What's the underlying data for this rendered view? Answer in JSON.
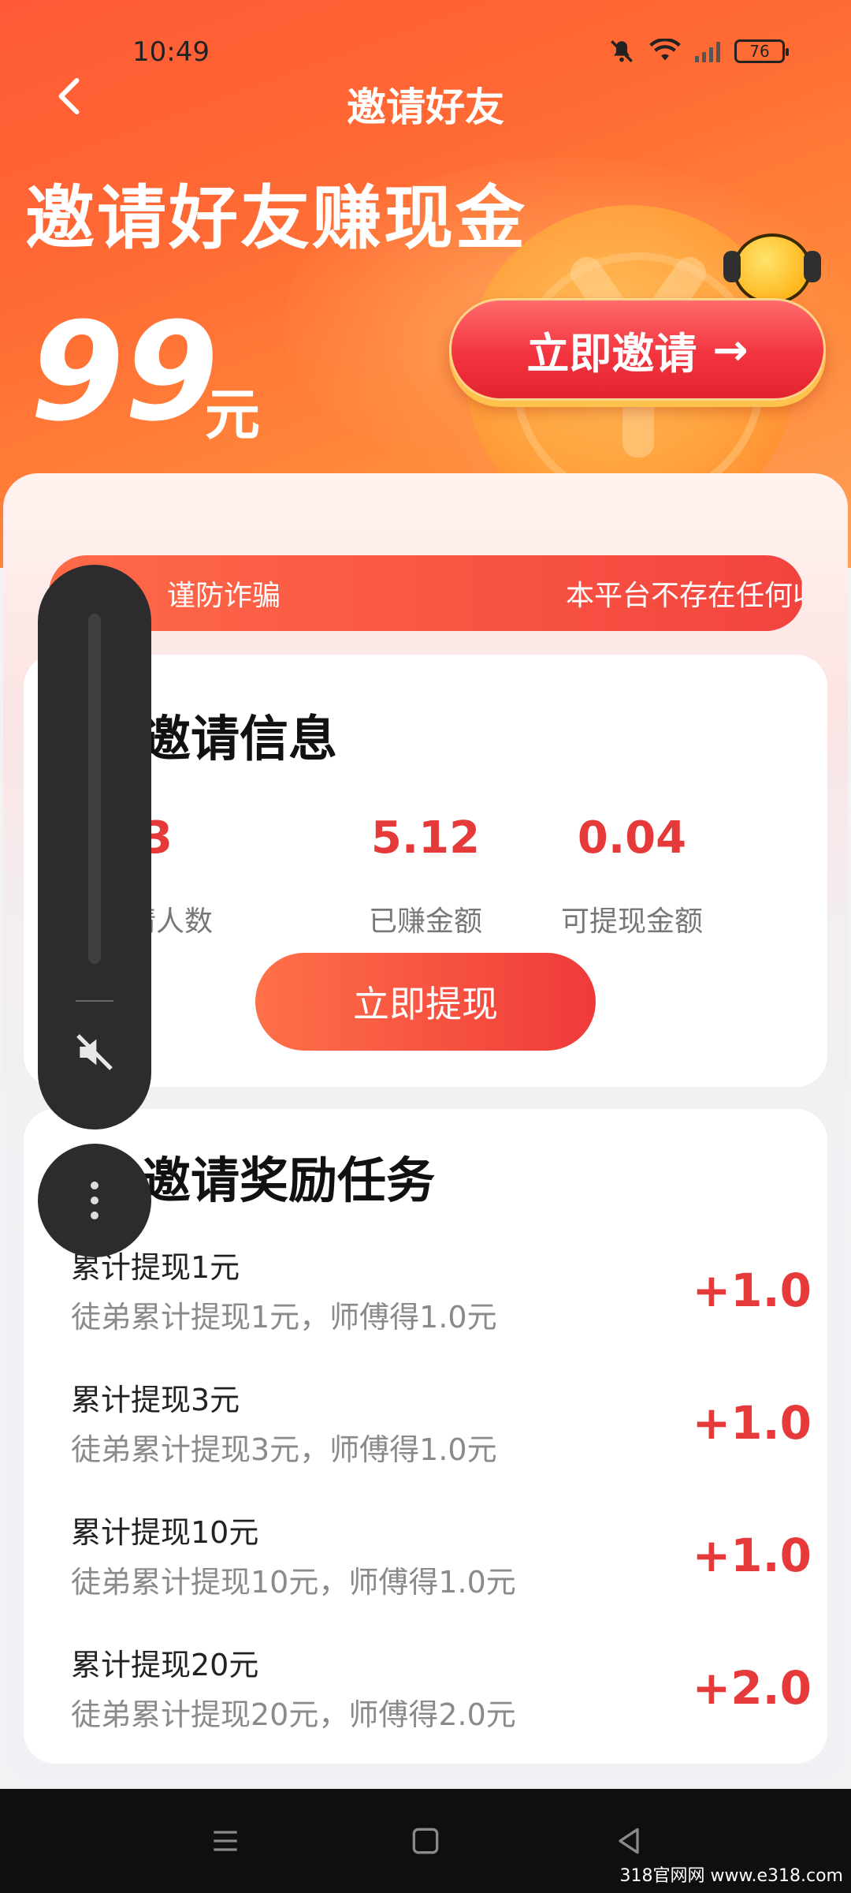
{
  "status_bar": {
    "time": "10:49",
    "battery": "76"
  },
  "header": {
    "title": "邀请好友"
  },
  "hero": {
    "title": "邀请好友赚现金",
    "amount": "99",
    "unit": "元",
    "invite_button": "立即邀请"
  },
  "notice": {
    "label": "谨防诈骗",
    "message": "本平台不存在任何收费"
  },
  "invite_info": {
    "title": "邀请信息",
    "stats": [
      {
        "value": "13",
        "label": "已邀请人数"
      },
      {
        "value": "5.12",
        "label": "已赚金额"
      },
      {
        "value": "0.04",
        "label": "可提现金额"
      }
    ],
    "withdraw_button": "立即提现"
  },
  "tasks": {
    "title": "邀请奖励任务",
    "items": [
      {
        "title": "累计提现1元",
        "desc": "徒弟累计提现1元，师傅得1.0元",
        "reward": "+1.0"
      },
      {
        "title": "累计提现3元",
        "desc": "徒弟累计提现3元，师傅得1.0元",
        "reward": "+1.0"
      },
      {
        "title": "累计提现10元",
        "desc": "徒弟累计提现10元，师傅得1.0元",
        "reward": "+1.0"
      },
      {
        "title": "累计提现20元",
        "desc": "徒弟累计提现20元，师傅得2.0元",
        "reward": "+2.0"
      }
    ]
  },
  "watermark": "318官网网 www.e318.com",
  "colors": {
    "accent": "#e63a3a",
    "hero_start": "#ff5a36",
    "hero_end": "#ffa15a"
  },
  "icons": [
    "back-arrow-icon",
    "mute-bell-icon",
    "wifi-icon",
    "signal-icon",
    "battery-icon",
    "volume-mute-icon",
    "more-dots-icon",
    "menu-icon",
    "home-icon",
    "back-triangle-icon"
  ]
}
